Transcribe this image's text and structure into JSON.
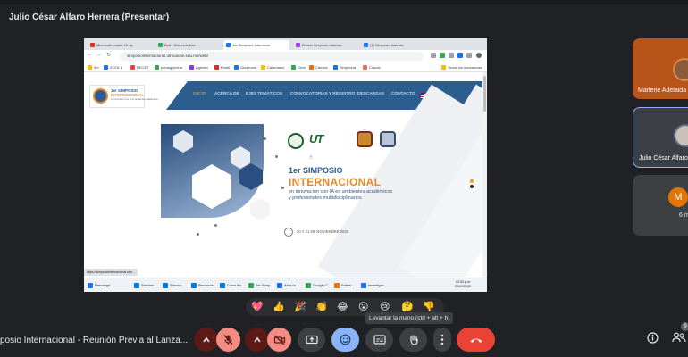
{
  "presenter": {
    "title": "Julio César Alfaro Herrera (Presentar)"
  },
  "browser": {
    "tabs": [
      {
        "label": "Microsoft Loader Gr ap",
        "fav": "#d93025"
      },
      {
        "label": "Bolt - Simposio Inte",
        "fav": "#34a853"
      },
      {
        "label": "1er Simposio Internacio",
        "fav": "#1a73e8"
      },
      {
        "label": "Primer Simposio Internac",
        "fav": "#a142f4"
      },
      {
        "label": "(1) Simposio Internac",
        "fav": "#1a73e8"
      }
    ],
    "url": "simposiointernacional.utmuacan.edu.mx/web/",
    "bookmarks": [
      {
        "label": "3m",
        "c": "#fbbc04"
      },
      {
        "label": "ZOTA 1",
        "c": "#1a73e8"
      },
      {
        "label": "RECET",
        "c": "#ea4335"
      },
      {
        "label": "pomagrprona",
        "c": "#34a853"
      },
      {
        "label": "Agenter",
        "c": "#9334e6"
      },
      {
        "label": "Email",
        "c": "#d93025"
      },
      {
        "label": "Gloseums",
        "c": "#1a73e8"
      },
      {
        "label": "Calendario",
        "c": "#fbbc04"
      },
      {
        "label": "Drive",
        "c": "#34a853"
      },
      {
        "label": "Canvas",
        "c": "#e37400"
      },
      {
        "label": "Simpriond",
        "c": "#1a73e8"
      },
      {
        "label": "Claude",
        "c": "#d97757"
      },
      {
        "label": "Todos los marcadores",
        "c": "#fbbc04"
      }
    ],
    "status_url": "https://simposiointernacional.utm..."
  },
  "site": {
    "logo_line1": "1er SIMPOSIO",
    "logo_line2": "INTERNACIONAL",
    "logo_line3": "en innovación con IA en ambientes académicos",
    "menu": [
      "INICIO",
      "ACERCA DE",
      "EJES TEMÁTICOS",
      "CONVOCATORIAS Y REGISTRO",
      "DESCARGAS",
      "CONTACTO"
    ],
    "title_line1": "1er SIMPOSIO",
    "title_line2": "INTERNACIONAL",
    "subtitle": "en innovación con IA en ambientes académicos y profesionales multidisciplinarios",
    "date": "20 Y 21 DE NOVIEMBRE 2025",
    "uts_logo": "UT"
  },
  "taskbar": {
    "items": [
      {
        "label": "Descarga",
        "c": "#1a73e8"
      },
      {
        "label": "Simulac",
        "c": "#0078d4"
      },
      {
        "label": "Simuso",
        "c": "#0078d4"
      },
      {
        "label": "Recursos",
        "c": "#0078d4"
      },
      {
        "label": "Consulta",
        "c": "#0078d4"
      },
      {
        "label": "1er Simp",
        "c": "#34a853"
      },
      {
        "label": "Abrir la",
        "c": "#1a73e8"
      },
      {
        "label": "Google C",
        "c": "#34a853"
      },
      {
        "label": "Entrev",
        "c": "#e37400"
      },
      {
        "label": "investigac",
        "c": "#1a73e8"
      }
    ],
    "time": "02:53 p.m.",
    "date": "23/10/2025"
  },
  "participants": [
    {
      "name": "Marlene Adelaida"
    },
    {
      "name": "Julio César Alfaro"
    },
    {
      "initial": "M",
      "count": "6 m"
    }
  ],
  "reactions": [
    "💖",
    "👍",
    "🎉",
    "👏",
    "😂",
    "😮",
    "😢",
    "🤔",
    "👎"
  ],
  "tooltip": "Levantar la mano (ctrl + alt + h)",
  "meeting": {
    "title": "posio Internacional - Reunión Previa al Lanza..."
  },
  "people_badge": "9",
  "colors": {
    "hangup": "#ea4335",
    "mic_off": "#f28b82",
    "accent": "#8ab4f8",
    "site_blue": "#2b5d8e",
    "site_orange": "#e58a2a"
  }
}
